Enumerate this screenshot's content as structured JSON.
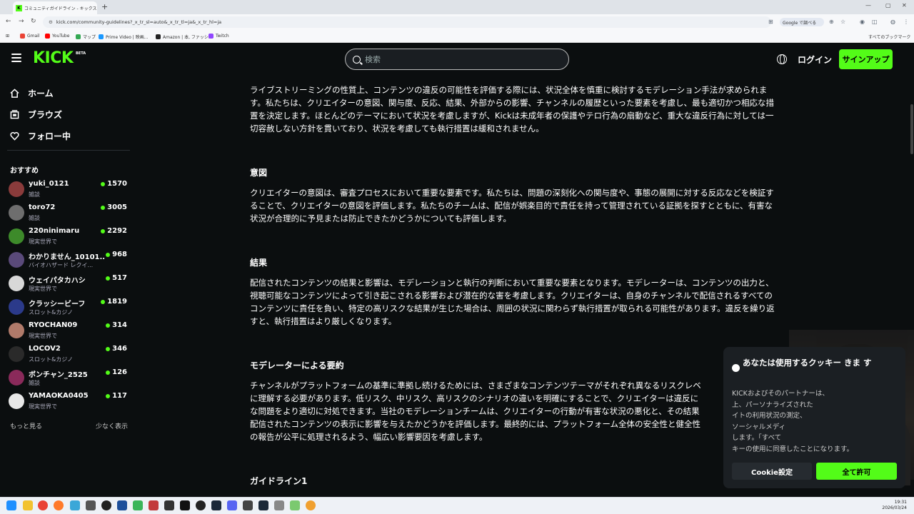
{
  "browser": {
    "tab_title": "コミュニティガイドライン - キックストリ",
    "url": "kick.com/community-guidelines?_x_tr_sl=auto&_x_tr_tl=ja&_x_tr_hl=ja",
    "google_translate": "Google で調べる",
    "bookmarks": [
      "Gmail",
      "YouTube",
      "マップ",
      "Prime Video | 映画...",
      "Amazon | 本, ファッシ...",
      "Twitch"
    ],
    "all_bookmarks": "すべてのブックマーク"
  },
  "header": {
    "logo": "KICK",
    "beta": "BETA",
    "search_placeholder": "検索",
    "login": "ログイン",
    "signup": "サインアップ"
  },
  "sidebar": {
    "nav": [
      {
        "label": "ホーム",
        "icon": "home-icon"
      },
      {
        "label": "ブラウズ",
        "icon": "browse-icon"
      },
      {
        "label": "フォロー中",
        "icon": "heart-icon"
      }
    ],
    "recommended_title": "おすすめ",
    "channels": [
      {
        "name": "yuki_0121",
        "category": "雑談",
        "viewers": "1570",
        "color": "#8a3b3b"
      },
      {
        "name": "toro72",
        "category": "雑談",
        "viewers": "3005",
        "color": "#6e6e6e"
      },
      {
        "name": "220ninimaru",
        "category": "現実世界で",
        "viewers": "2292",
        "color": "#3d8a2a"
      },
      {
        "name": "わかりません_10101...",
        "category": "バイオハザード レクイ...",
        "viewers": "968",
        "color": "#5a4a7a"
      },
      {
        "name": "ウェイパタカハシ",
        "category": "現実世界で",
        "viewers": "517",
        "color": "#d8d8d8"
      },
      {
        "name": "クラッシービーフ",
        "category": "スロット&カジノ",
        "viewers": "1819",
        "color": "#2b3a8a"
      },
      {
        "name": "RYOCHAN09",
        "category": "現実世界で",
        "viewers": "314",
        "color": "#b07a6a"
      },
      {
        "name": "LOCOV2",
        "category": "スロット&カジノ",
        "viewers": "346",
        "color": "#2a2a2a"
      },
      {
        "name": "ボンチャン_2525",
        "category": "雑談",
        "viewers": "126",
        "color": "#8a2a5a"
      },
      {
        "name": "YAMAOKA0405",
        "category": "現実世界で",
        "viewers": "117",
        "color": "#e8e8e8"
      }
    ],
    "show_more": "もっと見る",
    "show_less": "少なく表示"
  },
  "content": {
    "intro_lines": [
      "ライブストリーミングの性質上、コンテンツの違反の可能性を評価する際には、状況全体を慎重に検討するモデレーション手法が求められま",
      "す。私たちは、クリエイターの意図、関与度、反応、結果、外部からの影響、チャンネルの履歴といった要素を考慮し、最も適切かつ相応な措",
      "置を決定します。ほとんどのテーマにおいて状況を考慮しますが、Kickは未成年者の保護やテロ行為の扇動など、重大な違反行為に対しては一",
      "切容赦しない方針を貫いており、状況を考慮しても執行措置は緩和されません。"
    ],
    "intent_heading": "意図",
    "intent_lines": [
      "クリエイターの意図は、審査プロセスにおいて重要な要素です。私たちは、問題の深刻化への関与度や、事態の展開に対する反応などを検証す",
      "ることで、クリエイターの意図を評価します。私たちのチームは、配信が娯楽目的で責任を持って管理されている証拠を探すとともに、有害な",
      "状況が合理的に予見または防止できたかどうかについても評価します。"
    ],
    "result_heading": "結果",
    "result_lines": [
      "配信されたコンテンツの結果と影響は、モデレーションと執行の判断において重要な要素となります。モデレーターは、コンテンツの出力と、",
      "視聴可能なコンテンツによって引き起こされる影響および潜在的な害を考慮します。クリエイターは、自身のチャンネルで配信されるすべての",
      "コンテンツに責任を負い、特定の高リスクな結果が生じた場合は、周囲の状況に関わらず執行措置が取られる可能性があります。違反を繰り返",
      "すと、執行措置はより厳しくなります。"
    ],
    "moderator_heading": "モデレーターによる要約",
    "moderator_lines": [
      "チャンネルがプラットフォームの基準に準拠し続けるためには、さまざまなコンテンツテーマがそれぞれ異なるリスクレベ",
      "に理解する必要があります。低リスク、中リスク、高リスクのシナリオの違いを明確にすることで、クリエイターは違反に",
      "な問題をより適切に対処できます。当社のモデレーションチームは、クリエイターの行動が有害な状況の悪化と、その結果",
      "配信されたコンテンツの表示に影響を与えたかどうかを評価します。最終的には、プラットフォーム全体の安全性と健全性",
      "の報告が公平に処理されるよう、幅広い影響要因を考慮します。"
    ],
    "guideline_heading": "ガイドライン1"
  },
  "cookie": {
    "title": "あなたは使用するクッキー きま す",
    "body_lines": [
      "KICKおよびそのパートナーは、",
      "上、パーソナライズされた",
      "イトの利用状況の測定、",
      "ソーシャルメディ",
      "します。「すべて",
      "キーの使用に同意したことになります。"
    ],
    "settings_label": "Cookie設定",
    "accept_label": "全て許可"
  },
  "taskbar": {
    "time": "19:31",
    "date": "2026/03/24"
  }
}
